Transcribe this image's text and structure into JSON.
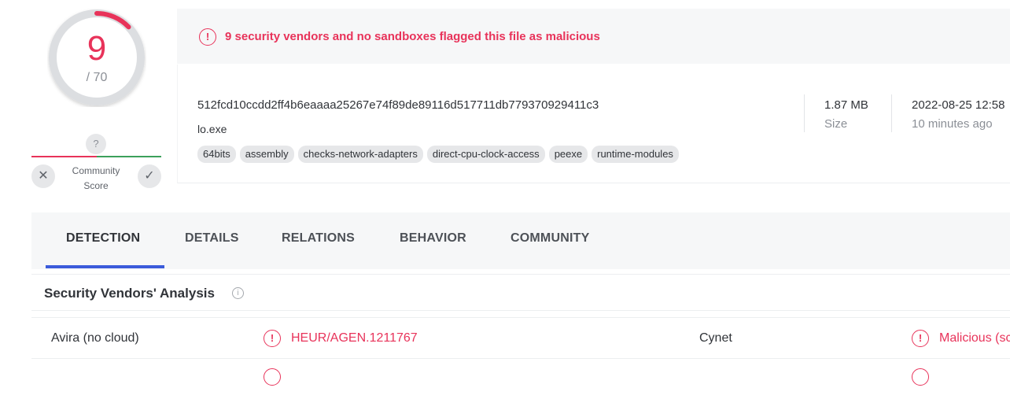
{
  "score": {
    "detections": "9",
    "total": "/ 70",
    "fraction": 0.1286
  },
  "community": {
    "unknown_glyph": "?",
    "label_line1": "Community",
    "label_line2": "Score"
  },
  "banner": {
    "text": "9 security vendors and no sandboxes flagged this file as malicious"
  },
  "file": {
    "hash": "512fcd10ccdd2ff4b6eaaaa25267e74f89de89116d517711db779370929411c3",
    "name": "lo.exe",
    "tags": [
      "64bits",
      "assembly",
      "checks-network-adapters",
      "direct-cpu-clock-access",
      "peexe",
      "runtime-modules"
    ],
    "size_value": "1.87 MB",
    "size_label": "Size",
    "date_value": "2022-08-25 12:58",
    "date_label": "10 minutes ago"
  },
  "tabs": [
    "DETECTION",
    "DETAILS",
    "RELATIONS",
    "BEHAVIOR",
    "COMMUNITY"
  ],
  "analysis": {
    "title": "Security Vendors' Analysis",
    "rows": [
      {
        "vendor1": "Avira (no cloud)",
        "result1": "HEUR/AGEN.1211767",
        "vendor2": "Cynet",
        "result2": "Malicious (sc"
      }
    ]
  },
  "colors": {
    "malicious": "#e8335a",
    "accent": "#3b5bdb",
    "community_green": "#3ca05b"
  }
}
